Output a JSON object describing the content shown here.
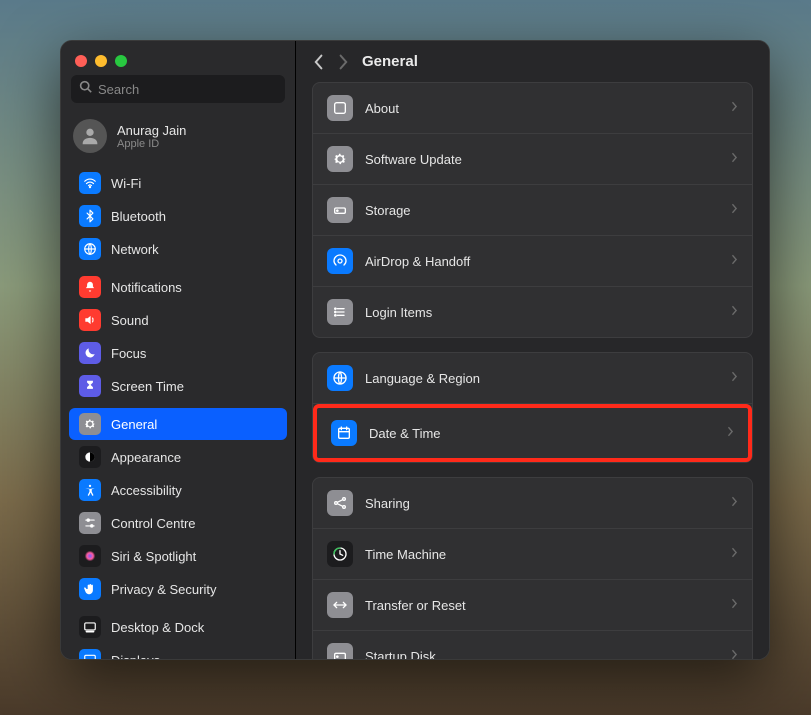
{
  "search": {
    "placeholder": "Search"
  },
  "user": {
    "name": "Anurag Jain",
    "sub": "Apple ID"
  },
  "page": {
    "title": "General"
  },
  "sidebar": {
    "groups": [
      {
        "items": [
          {
            "id": "wifi",
            "label": "Wi-Fi",
            "bg": "#0a7aff",
            "icon": "wifi"
          },
          {
            "id": "bluetooth",
            "label": "Bluetooth",
            "bg": "#0a7aff",
            "icon": "bluetooth"
          },
          {
            "id": "network",
            "label": "Network",
            "bg": "#0a7aff",
            "icon": "network"
          }
        ]
      },
      {
        "items": [
          {
            "id": "notifications",
            "label": "Notifications",
            "bg": "#ff3b30",
            "icon": "bell"
          },
          {
            "id": "sound",
            "label": "Sound",
            "bg": "#ff3b30",
            "icon": "sound"
          },
          {
            "id": "focus",
            "label": "Focus",
            "bg": "#5e5ce6",
            "icon": "moon"
          },
          {
            "id": "screen-time",
            "label": "Screen Time",
            "bg": "#5e5ce6",
            "icon": "hourglass"
          }
        ]
      },
      {
        "items": [
          {
            "id": "general",
            "label": "General",
            "bg": "#8e8e93",
            "icon": "gear",
            "selected": true
          },
          {
            "id": "appearance",
            "label": "Appearance",
            "bg": "#1c1c1e",
            "icon": "appearance"
          },
          {
            "id": "accessibility",
            "label": "Accessibility",
            "bg": "#0a7aff",
            "icon": "accessibility"
          },
          {
            "id": "control-centre",
            "label": "Control Centre",
            "bg": "#8e8e93",
            "icon": "switches"
          },
          {
            "id": "siri",
            "label": "Siri & Spotlight",
            "bg": "#1c1c1e",
            "icon": "siri"
          },
          {
            "id": "privacy",
            "label": "Privacy & Security",
            "bg": "#0a7aff",
            "icon": "hand"
          }
        ]
      },
      {
        "items": [
          {
            "id": "desktop-dock",
            "label": "Desktop & Dock",
            "bg": "#1c1c1e",
            "icon": "dock"
          },
          {
            "id": "displays",
            "label": "Displays",
            "bg": "#0a7aff",
            "icon": "display"
          }
        ]
      }
    ]
  },
  "panels": [
    {
      "rows": [
        {
          "id": "about",
          "label": "About",
          "bg": "#8e8e93",
          "icon": "info"
        },
        {
          "id": "software-update",
          "label": "Software Update",
          "bg": "#8e8e93",
          "icon": "gear"
        },
        {
          "id": "storage",
          "label": "Storage",
          "bg": "#8e8e93",
          "icon": "storage"
        },
        {
          "id": "airdrop",
          "label": "AirDrop & Handoff",
          "bg": "#0a7aff",
          "icon": "airdrop"
        },
        {
          "id": "login-items",
          "label": "Login Items",
          "bg": "#8e8e93",
          "icon": "list"
        }
      ]
    },
    {
      "rows": [
        {
          "id": "language-region",
          "label": "Language & Region",
          "bg": "#0a7aff",
          "icon": "globe"
        },
        {
          "id": "date-time",
          "label": "Date & Time",
          "bg": "#0a7aff",
          "icon": "calendar",
          "highlighted": true
        }
      ]
    },
    {
      "rows": [
        {
          "id": "sharing",
          "label": "Sharing",
          "bg": "#8e8e93",
          "icon": "share"
        },
        {
          "id": "time-machine",
          "label": "Time Machine",
          "bg": "#1c1c1e",
          "icon": "timemachine"
        },
        {
          "id": "transfer-reset",
          "label": "Transfer or Reset",
          "bg": "#8e8e93",
          "icon": "transfer"
        },
        {
          "id": "startup-disk",
          "label": "Startup Disk",
          "bg": "#8e8e93",
          "icon": "disk"
        }
      ]
    }
  ]
}
